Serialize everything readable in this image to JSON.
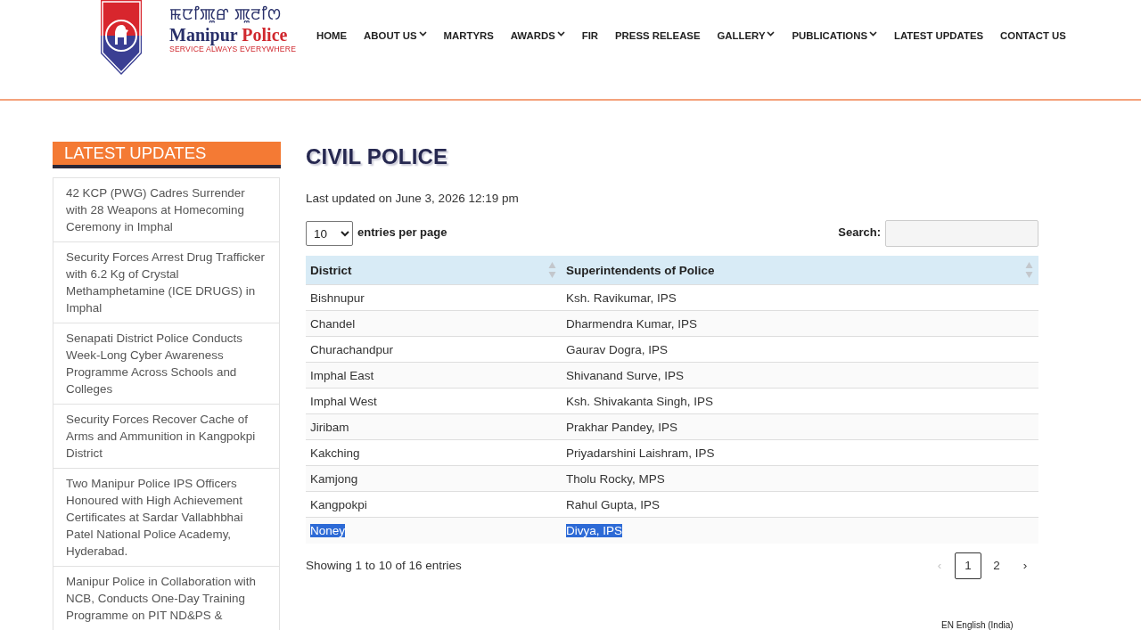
{
  "header": {
    "logo": {
      "script_text": "ꯃꯅꯤꯄꯨꯔ ꯄꯨꯂꯤꯁ",
      "wordmark": [
        {
          "text": "Manipur",
          "color": "#29306a"
        },
        {
          "text": "Police",
          "color": "#d0282e"
        }
      ],
      "tagline": "SERVICE ALWAYS EVERYWHERE"
    },
    "nav": [
      {
        "label": "HOME",
        "dropdown": false
      },
      {
        "label": "ABOUT US",
        "dropdown": true
      },
      {
        "label": "MARTYRS",
        "dropdown": false
      },
      {
        "label": "AWARDS",
        "dropdown": true
      },
      {
        "label": "FIR",
        "dropdown": false
      },
      {
        "label": "PRESS RELEASE",
        "dropdown": false
      },
      {
        "label": "GALLERY",
        "dropdown": true
      },
      {
        "label": "PUBLICATIONS",
        "dropdown": true
      },
      {
        "label": "LATEST UPDATES",
        "dropdown": false
      },
      {
        "label": "CONTACT US",
        "dropdown": false
      }
    ]
  },
  "sidebar": {
    "title": "LATEST UPDATES",
    "items": [
      "42 KCP (PWG) Cadres Surrender with 28 Weapons at Homecoming Ceremony in Imphal",
      "Security Forces Arrest Drug Trafficker with 6.2 Kg of Crystal Methamphetamine (ICE DRUGS) in Imphal",
      "Senapati District Police Conducts Week-Long Cyber Awareness Programme Across Schools and Colleges",
      "Security Forces Recover Cache of Arms and Ammunition in Kangpokpi District",
      "Two Manipur Police IPS Officers Honoured with High Achievement Certificates at Sardar Vallabhbhai Patel National Police Academy, Hyderabad.",
      "Manipur Police in Collaboration with NCB, Conducts One-Day Training Programme on PIT ND&PS &"
    ]
  },
  "main": {
    "title": "CIVIL POLICE",
    "last_updated": "Last updated on June 3, 2026 12:19 pm",
    "page_length": "10",
    "page_length_label": "entries per page",
    "search_label": "Search:",
    "table": {
      "columns": [
        "District",
        "Superintendents of Police"
      ],
      "rows": [
        {
          "district": "Bishnupur",
          "officer": "Ksh. Ravikumar, IPS",
          "selected": false
        },
        {
          "district": "Chandel",
          "officer": "Dharmendra Kumar, IPS",
          "selected": false
        },
        {
          "district": "Churachandpur",
          "officer": "Gaurav Dogra, IPS",
          "selected": false
        },
        {
          "district": "Imphal East",
          "officer": "Shivanand Surve, IPS",
          "selected": false
        },
        {
          "district": "Imphal West",
          "officer": "Ksh. Shivakanta Singh, IPS",
          "selected": false
        },
        {
          "district": "Jiribam",
          "officer": "Prakhar Pandey, IPS",
          "selected": false
        },
        {
          "district": "Kakching",
          "officer": "Priyadarshini Laishram, IPS",
          "selected": false
        },
        {
          "district": "Kamjong",
          "officer": "Tholu Rocky, MPS",
          "selected": false
        },
        {
          "district": "Kangpokpi",
          "officer": "Rahul Gupta, IPS",
          "selected": false
        },
        {
          "district": "Noney",
          "officer": "Divya, IPS",
          "selected": true
        }
      ]
    },
    "info": "Showing 1 to 10 of 16 entries",
    "pagination": [
      {
        "label": "‹",
        "selected": false,
        "disabled": true
      },
      {
        "label": "1",
        "selected": true,
        "disabled": false
      },
      {
        "label": "2",
        "selected": false,
        "disabled": false
      },
      {
        "label": "›",
        "selected": false,
        "disabled": false
      }
    ]
  },
  "language_indicator": "EN English (India)"
}
